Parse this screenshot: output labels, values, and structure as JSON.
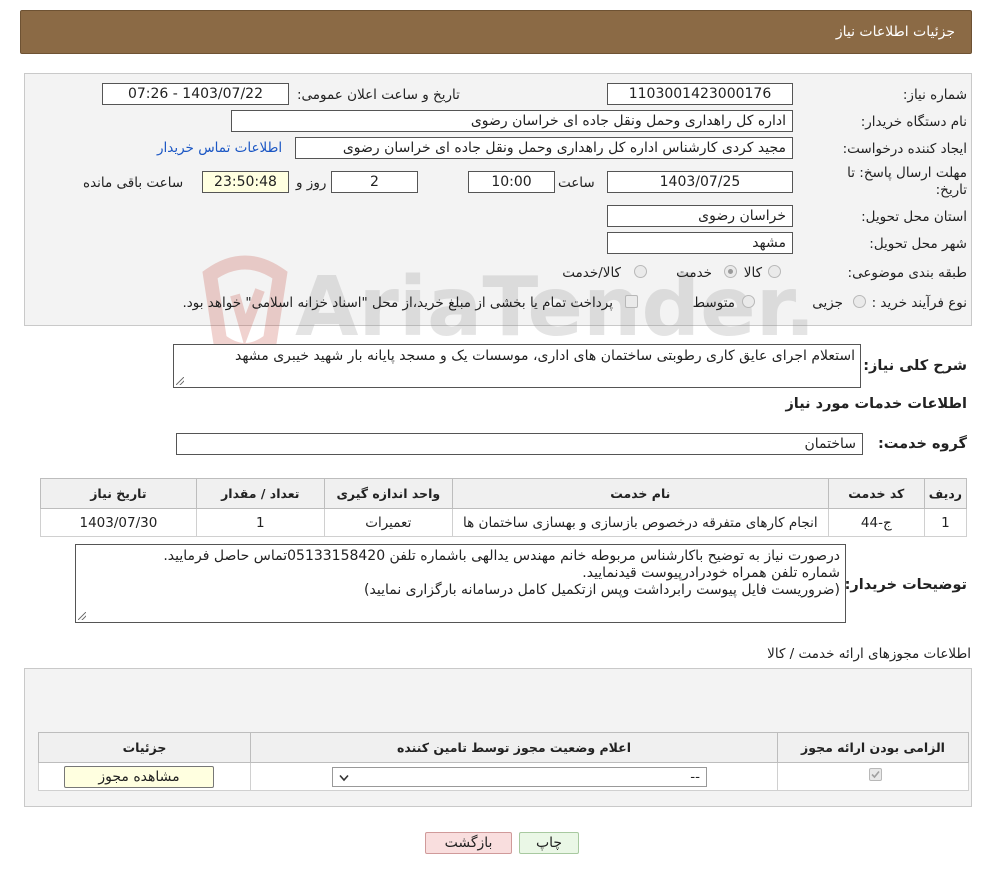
{
  "header": {
    "title": "جزئیات اطلاعات نیاز"
  },
  "form": {
    "need_number": {
      "label": "شماره نیاز:",
      "value": "1103001423000176"
    },
    "announce_datetime": {
      "label": "تاریخ و ساعت اعلان عمومی:",
      "value": "1403/07/22 - 07:26"
    },
    "buyer_org": {
      "label": "نام دستگاه خریدار:",
      "value": "اداره کل راهداری وحمل ونقل جاده ای خراسان رضوی"
    },
    "requester": {
      "label": "ایجاد کننده درخواست:",
      "value": "مجید کردی کارشناس اداره کل راهداری وحمل ونقل جاده ای خراسان رضوی",
      "contact_link": "اطلاعات تماس خریدار"
    },
    "deadline": {
      "label": "مهلت ارسال پاسخ: تا تاریخ:",
      "date": "1403/07/25",
      "time_label": "ساعت",
      "time": "10:00",
      "days": "2",
      "days_label": "روز و",
      "remaining": "23:50:48",
      "remaining_label": "ساعت باقی مانده"
    },
    "province": {
      "label": "استان محل تحویل:",
      "value": "خراسان رضوی"
    },
    "city": {
      "label": "شهر محل تحویل:",
      "value": "مشهد"
    },
    "category": {
      "label": "طبقه بندی موضوعی:",
      "options": [
        "کالا",
        "خدمت",
        "کالا/خدمت"
      ],
      "selected": "خدمت"
    },
    "purchase_type": {
      "label": "نوع فرآیند خرید :",
      "options": [
        "جزیی",
        "متوسط"
      ],
      "payment_note": "پرداخت تمام یا بخشی از مبلغ خرید،از محل \"اسناد خزانه اسلامی\" خواهد بود."
    },
    "general_description": {
      "label": "شرح کلی نیاز:",
      "value": "استعلام اجرای عایق کاری رطوبتی ساختمان های اداری، موسسات یک و مسجد پایانه بار شهید خیبری مشهد"
    }
  },
  "services": {
    "section_title": "اطلاعات خدمات مورد نیاز",
    "group_label": "گروه خدمت:",
    "group_value": "ساختمان",
    "table": {
      "headers": [
        "ردیف",
        "کد خدمت",
        "نام خدمت",
        "واحد اندازه گیری",
        "تعداد / مقدار",
        "تاریخ نیاز"
      ],
      "rows": [
        [
          "1",
          "ج-44",
          "انجام کارهای متفرقه درخصوص بازسازی و بهسازی ساختمان ها",
          "تعمیرات",
          "1",
          "1403/07/30"
        ]
      ]
    }
  },
  "buyer_notes": {
    "label": "توضیحات خریدار:",
    "lines": [
      "درصورت نیاز به توضیح باکارشناس مربوطه خانم مهندس یدالهی باشماره تلفن 05133158420تماس حاصل فرمایید.",
      "شماره تلفن همراه خودرادرپیوست قیدنمایید.",
      "(ضروریست فایل پیوست رابرداشت وپس ازتکمیل کامل درسامانه بارگزاری نمایید)"
    ]
  },
  "permits": {
    "section_title": "اطلاعات مجوزهای ارائه خدمت / کالا",
    "table": {
      "headers": [
        "الزامی بودن ارائه مجوز",
        "اعلام وضعیت مجوز توسط تامین کننده",
        "جزئیات"
      ],
      "rows": [
        {
          "required_checked": true,
          "status_select": "--",
          "details_button": "مشاهده مجوز"
        }
      ]
    }
  },
  "actions": {
    "print": "چاپ",
    "back": "بازگشت"
  },
  "watermark": {
    "text": "AriaTender.neT"
  },
  "colors": {
    "header_bg": "#8b6a45",
    "link": "#1a56c4",
    "back_btn_bg": "#f9dede",
    "print_btn_bg": "#eaf7e6",
    "highlight_box": "#ffffe0"
  }
}
